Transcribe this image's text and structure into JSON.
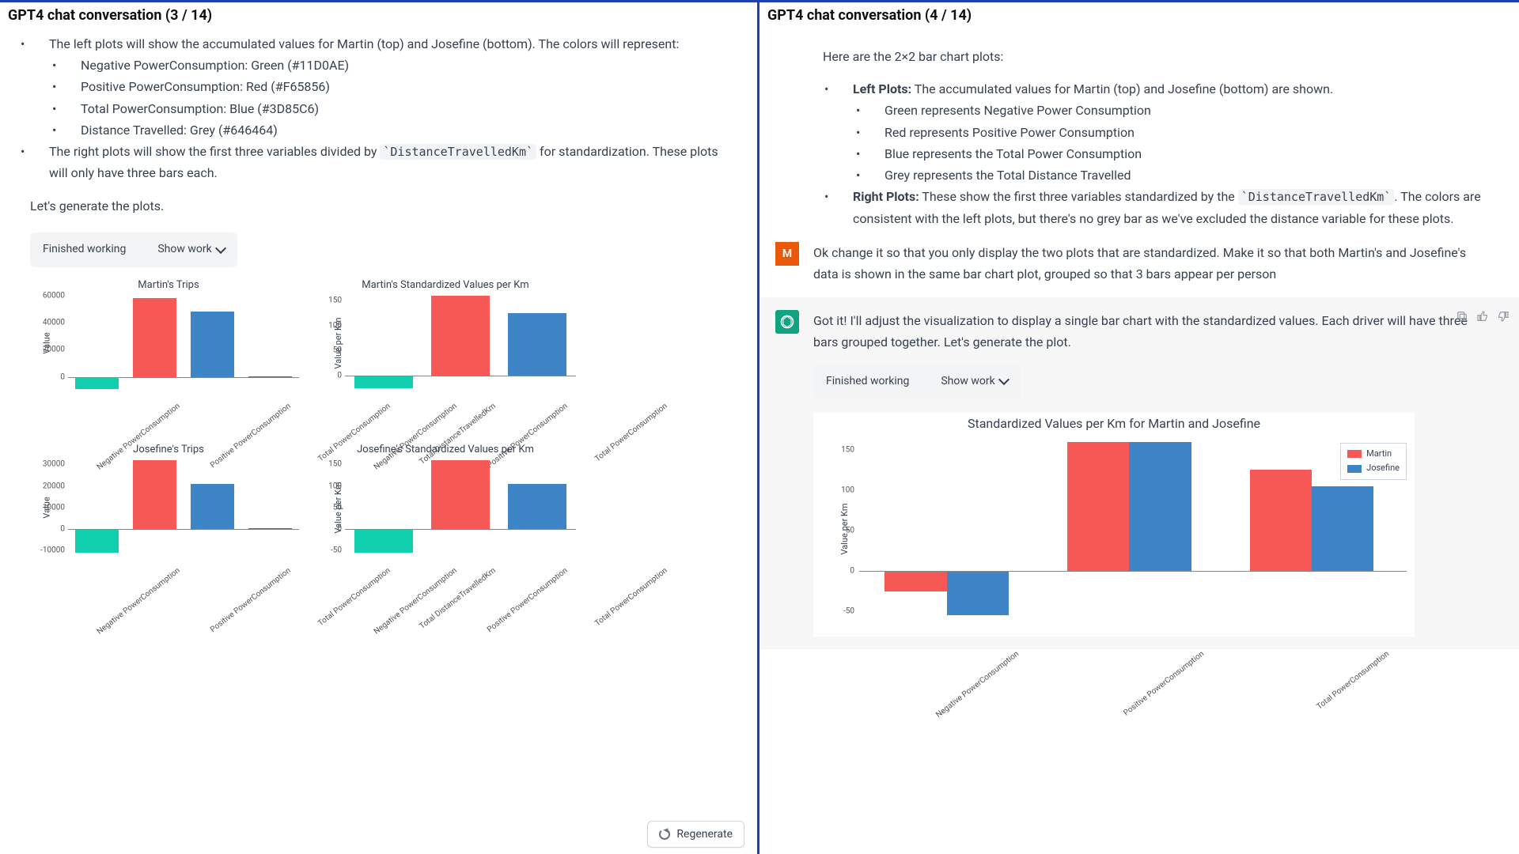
{
  "colors": {
    "green": "#11D0AE",
    "red": "#F65856",
    "blue": "#3D85C6",
    "grey": "#646464"
  },
  "left": {
    "title": "GPT4 chat conversation (3 / 14)",
    "bullet1": "The left plots will show the accumulated values for Martin (top) and Josefine (bottom). The colors will represent:",
    "sub1": "Negative PowerConsumption: Green (#11D0AE)",
    "sub2": "Positive PowerConsumption: Red (#F65856)",
    "sub3": "Total PowerConsumption: Blue (#3D85C6)",
    "sub4": "Distance Travelled: Grey (#646464)",
    "bullet2a": "The right plots will show the first three variables divided by ",
    "bullet2_code": "`DistanceTravelledKm`",
    "bullet2b": " for standardization. These plots will only have three bars each.",
    "lets_generate": "Let's generate the plots.",
    "finished": "Finished working",
    "show_work": "Show work",
    "regenerate": "Regenerate",
    "charts": {
      "martin_trips": "Martin's Trips",
      "martin_std": "Martin's Standardized Values per Km",
      "josefine_trips": "Josefine's Trips",
      "josefine_std": "Josefine's Standardized Values per Km",
      "ylabel_value": "Value",
      "ylabel_vpk": "Value per Km",
      "cats4": [
        "Negative PowerConsumption",
        "Positive PowerConsumption",
        "Total PowerConsumption",
        "Total DistanceTravelledKm"
      ],
      "cats3": [
        "Negative PowerConsumption",
        "Positive PowerConsumption",
        "Total PowerConsumption"
      ]
    }
  },
  "right": {
    "title": "GPT4 chat conversation (4 / 14)",
    "intro": "Here are the 2×2 bar chart plots:",
    "lp_label": "Left Plots:",
    "lp_text": " The accumulated values for Martin (top) and Josefine (bottom) are shown.",
    "lp1": "Green represents Negative Power Consumption",
    "lp2": "Red represents Positive Power Consumption",
    "lp3": "Blue represents the Total Power Consumption",
    "lp4": "Grey represents the Total Distance Travelled",
    "rp_label": "Right Plots:",
    "rp_text1": " These show the first three variables standardized by the ",
    "rp_code": "`DistanceTravelledKm`",
    "rp_text2": ". The colors are consistent with the left plots, but there's no grey bar as we've excluded the distance variable for these plots.",
    "user_msg": "Ok change it so that you only display the two plots that are standardized. Make it so that both Martin's and Josefine's data is shown in the same bar chart plot, grouped so that 3 bars appear per person",
    "ai_msg": "Got it! I'll adjust the visualization to display a single bar chart with the standardized values. Each driver will have three bars grouped together. Let's generate the plot.",
    "finished": "Finished working",
    "show_work": "Show work",
    "big_chart": {
      "title": "Standardized Values per Km for Martin and Josefine",
      "ylabel": "Value per Km",
      "cats": [
        "Negative PowerConsumption",
        "Positive PowerConsumption",
        "Total PowerConsumption"
      ],
      "legend": [
        "Martin",
        "Josefine"
      ],
      "yticks": [
        "-50",
        "0",
        "50",
        "100",
        "150"
      ]
    }
  },
  "chart_data": [
    {
      "type": "bar",
      "title": "Martin's Trips",
      "ylabel": "Value",
      "categories": [
        "Negative PowerConsumption",
        "Positive PowerConsumption",
        "Total PowerConsumption",
        "Total DistanceTravelledKm"
      ],
      "values": [
        -9000,
        58000,
        48000,
        400
      ],
      "colors": [
        "#11D0AE",
        "#F65856",
        "#3D85C6",
        "#646464"
      ],
      "ylim": [
        -10000,
        60000
      ],
      "yticks": [
        0,
        20000,
        40000,
        60000
      ]
    },
    {
      "type": "bar",
      "title": "Martin's Standardized Values per Km",
      "ylabel": "Value per Km",
      "categories": [
        "Negative PowerConsumption",
        "Positive PowerConsumption",
        "Total PowerConsumption"
      ],
      "values": [
        -25,
        160,
        125
      ],
      "colors": [
        "#11D0AE",
        "#F65856",
        "#3D85C6"
      ],
      "ylim": [
        -30,
        160
      ],
      "yticks": [
        0,
        50,
        100,
        150
      ]
    },
    {
      "type": "bar",
      "title": "Josefine's Trips",
      "ylabel": "Value",
      "categories": [
        "Negative PowerConsumption",
        "Positive PowerConsumption",
        "Total PowerConsumption",
        "Total DistanceTravelledKm"
      ],
      "values": [
        -11000,
        32000,
        21000,
        300
      ],
      "colors": [
        "#11D0AE",
        "#F65856",
        "#3D85C6",
        "#646464"
      ],
      "ylim": [
        -12000,
        32000
      ],
      "yticks": [
        -10000,
        0,
        10000,
        20000,
        30000
      ]
    },
    {
      "type": "bar",
      "title": "Josefine's Standardized Values per Km",
      "ylabel": "Value per Km",
      "categories": [
        "Negative PowerConsumption",
        "Positive PowerConsumption",
        "Total PowerConsumption"
      ],
      "values": [
        -55,
        160,
        105
      ],
      "colors": [
        "#11D0AE",
        "#F65856",
        "#3D85C6"
      ],
      "ylim": [
        -60,
        160
      ],
      "yticks": [
        -50,
        0,
        50,
        100,
        150
      ]
    },
    {
      "type": "bar",
      "title": "Standardized Values per Km for Martin and Josefine",
      "ylabel": "Value per Km",
      "categories": [
        "Negative PowerConsumption",
        "Positive PowerConsumption",
        "Total PowerConsumption"
      ],
      "series": [
        {
          "name": "Martin",
          "values": [
            -25,
            160,
            125
          ],
          "color": "#F65856"
        },
        {
          "name": "Josefine",
          "values": [
            -55,
            160,
            105
          ],
          "color": "#3D85C6"
        }
      ],
      "ylim": [
        -60,
        165
      ],
      "yticks": [
        -50,
        0,
        50,
        100,
        150
      ]
    }
  ]
}
